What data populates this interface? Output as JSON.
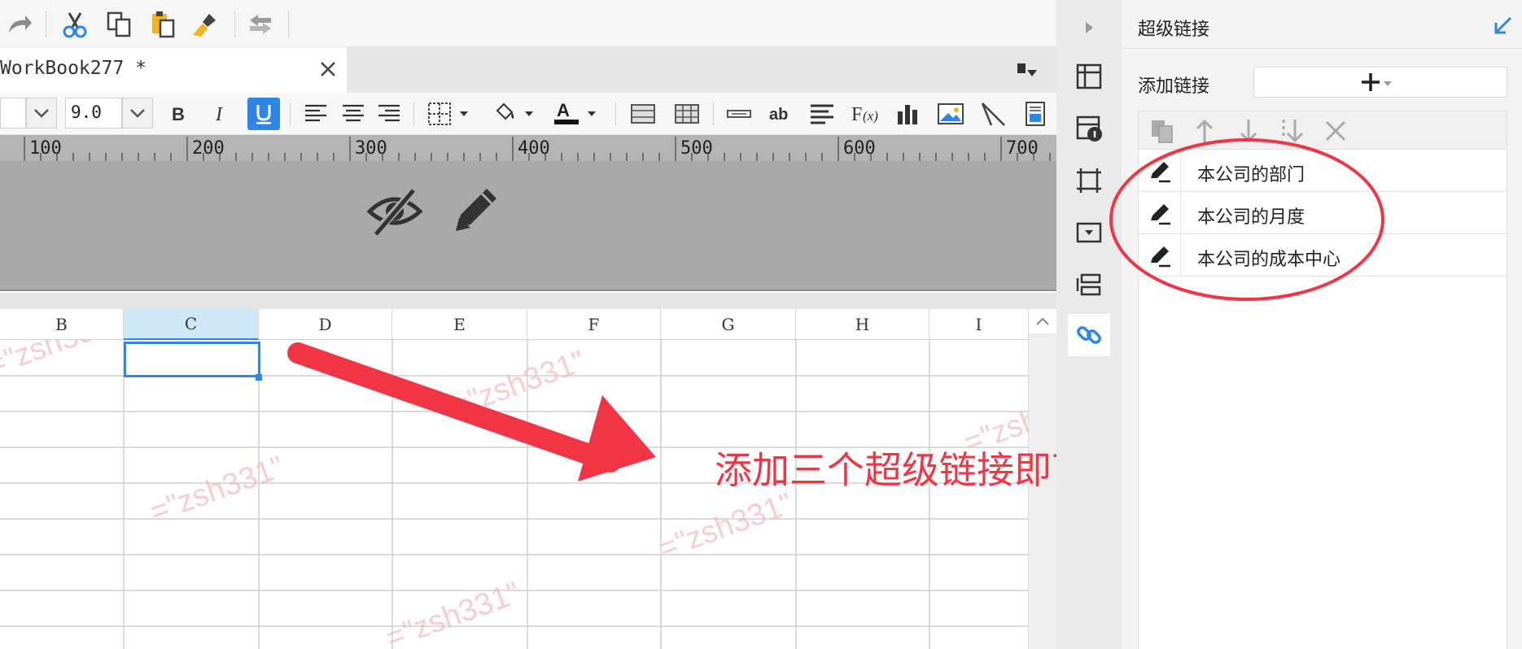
{
  "document": {
    "tab_title": "WorkBook277 *"
  },
  "format_toolbar": {
    "font_size": "9.0"
  },
  "ruler": {
    "labels": [
      "100",
      "200",
      "300",
      "400",
      "500",
      "600",
      "700"
    ]
  },
  "columns": [
    "B",
    "C",
    "D",
    "E",
    "F",
    "G",
    "H",
    "I"
  ],
  "selected_column": "C",
  "panel": {
    "title": "超级链接",
    "add_link_label": "添加链接",
    "links": [
      "本公司的部门",
      "本公司的月度",
      "本公司的成本中心"
    ]
  },
  "annotation": {
    "text": "添加三个超级链接即可；"
  },
  "watermark": "=\"zsh331\"",
  "colors": {
    "accent_blue": "#2f86e6",
    "annotation_red": "#f03545",
    "selection_header": "#cfe8f7"
  }
}
